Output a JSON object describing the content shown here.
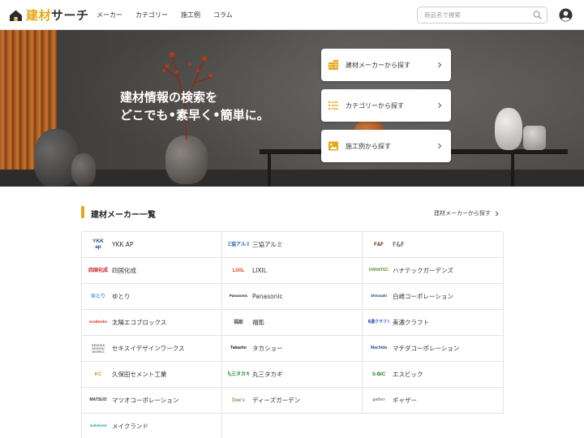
{
  "header": {
    "logo_text_accent": "建材",
    "logo_text_main": "サーチ",
    "nav": [
      "メーカー",
      "カテゴリー",
      "施工例",
      "コラム"
    ],
    "search_placeholder": "商品名で検索"
  },
  "hero": {
    "title_line1": "建材情報の検索を",
    "title_line2": "どこでも•素早く•簡単に。",
    "cards": [
      {
        "label": "建材メーカーから探す",
        "icon": "building-icon"
      },
      {
        "label": "カテゴリーから探す",
        "icon": "list-icon"
      },
      {
        "label": "施工例から探す",
        "icon": "image-icon"
      }
    ]
  },
  "makers_section": {
    "title": "建材メーカー一覧",
    "link_label": "建材メーカーから探す",
    "makers": [
      {
        "name": "YKK AP",
        "logo": "YKK\nap",
        "color": "#1f4e9a"
      },
      {
        "name": "三協アルミ",
        "logo": "三協アルミ",
        "color": "#2a5fb0"
      },
      {
        "name": "F&F",
        "logo": "F&F",
        "color": "#5a2a1a"
      },
      {
        "name": "四国化成",
        "logo": "四国化成",
        "color": "#c8202a"
      },
      {
        "name": "LIXIL",
        "logo": "LIXIL",
        "color": "#e04a1a"
      },
      {
        "name": "ハナテックガーデンズ",
        "logo": "HANATEC",
        "color": "#6b8a3a"
      },
      {
        "name": "ゆとり",
        "logo": "ゆとり",
        "color": "#3a9ad9"
      },
      {
        "name": "Panasonic",
        "logo": "Panasonic",
        "color": "#1a1a1a"
      },
      {
        "name": "白崎コーポレーション",
        "logo": "Shirasaki",
        "color": "#1f3a7a"
      },
      {
        "name": "太陽エコブロックス",
        "logo": "ecoblocks",
        "color": "#d42020"
      },
      {
        "name": "福彫",
        "logo": "福彫",
        "color": "#555555"
      },
      {
        "name": "美濃クラフト",
        "logo": "美濃クラフト",
        "color": "#2a5aa8"
      },
      {
        "name": "セキスイデザインワークス",
        "logo": "SEKISUI\nDESIGN\nWORKS",
        "color": "#777777"
      },
      {
        "name": "タカショー",
        "logo": "Takasho",
        "color": "#1a1a1a"
      },
      {
        "name": "マチダコーポレーション",
        "logo": "Machida",
        "color": "#1f4e9a"
      },
      {
        "name": "久保田セメント工業",
        "logo": "KC",
        "color": "#c89a2a"
      },
      {
        "name": "丸三タカギ",
        "logo": "丸三タカギ",
        "color": "#2a8a3a"
      },
      {
        "name": "エスビック",
        "logo": "S-BIC",
        "color": "#2a7a2a"
      },
      {
        "name": "マツオコーポレーション",
        "logo": "MATSUO",
        "color": "#333333"
      },
      {
        "name": "ディーズガーデン",
        "logo": "Dee's",
        "color": "#8aa05a"
      },
      {
        "name": "ギャザー",
        "logo": "gather",
        "color": "#888888"
      },
      {
        "name": "メイクランド",
        "logo": "makeland",
        "color": "#2aa8a0"
      }
    ]
  },
  "colors": {
    "accent": "#e6a817"
  }
}
